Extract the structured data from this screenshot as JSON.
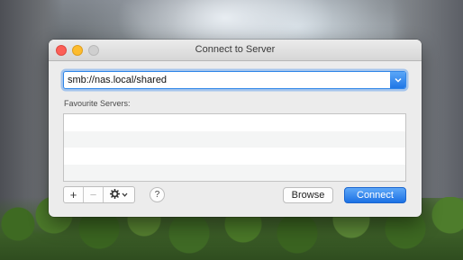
{
  "window": {
    "title": "Connect to Server"
  },
  "address": {
    "value": "smb://nas.local/shared",
    "dropdown_icon": "chevron-down-icon"
  },
  "favourites": {
    "label": "Favourite Servers:",
    "items": [
      "",
      "",
      "",
      ""
    ]
  },
  "toolbar": {
    "add_label": "+",
    "remove_label": "−",
    "action_icon": "gear-icon",
    "chevron": "⌄",
    "help_label": "?"
  },
  "buttons": {
    "browse_label": "Browse",
    "connect_label": "Connect"
  },
  "colors": {
    "accent": "#1f76e6",
    "close": "#fc5f57",
    "minimize": "#fdbc2e"
  }
}
